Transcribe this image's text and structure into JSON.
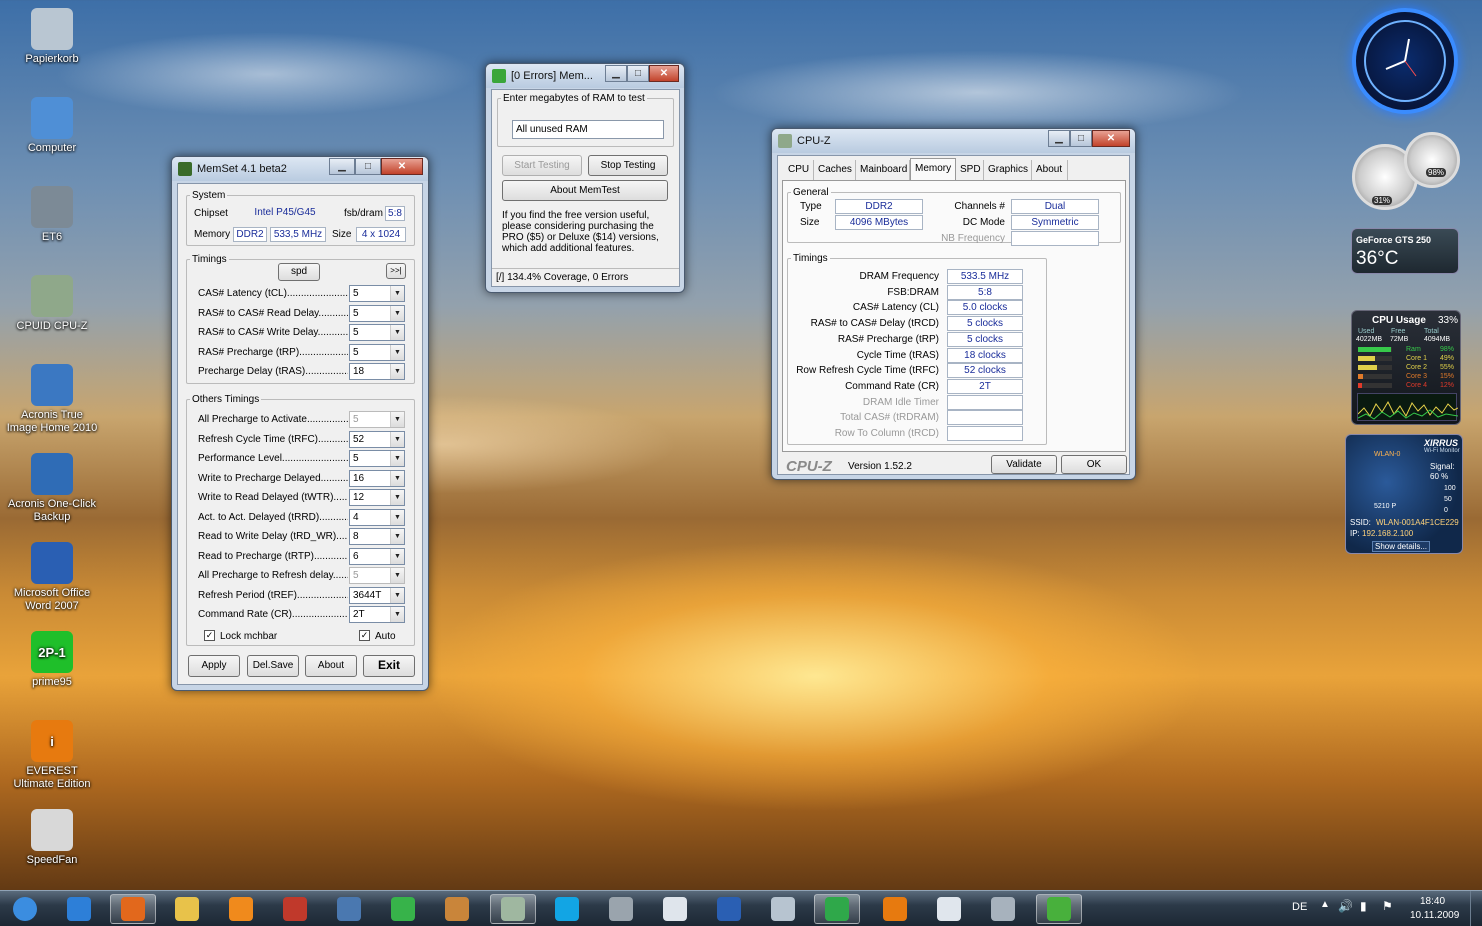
{
  "desktop_icons": [
    {
      "label": "Papierkorb",
      "icon": "recycle-bin-icon",
      "color": "#b9c6d2"
    },
    {
      "label": "Computer",
      "icon": "computer-icon",
      "color": "#4f8fd6"
    },
    {
      "label": "ET6",
      "icon": "et6-icon",
      "color": "#7c8a96"
    },
    {
      "label": "CPUID CPU-Z",
      "icon": "cpuz-icon",
      "color": "#8fa88a"
    },
    {
      "label": "Acronis True Image Home 2010",
      "icon": "acronis-true-image-icon",
      "color": "#3b78c2"
    },
    {
      "label": "Acronis One-Click Backup",
      "icon": "acronis-backup-icon",
      "color": "#2f6cb6"
    },
    {
      "label": "Microsoft Office Word 2007",
      "icon": "word-icon",
      "color": "#2a5fb3"
    },
    {
      "label": "prime95",
      "icon": "prime95-icon",
      "color": "#1fbf2a",
      "glyph": "2P-1"
    },
    {
      "label": "EVEREST Ultimate Edition",
      "icon": "everest-icon",
      "color": "#e77a0f",
      "glyph": "i"
    },
    {
      "label": "SpeedFan",
      "icon": "speedfan-icon",
      "color": "#d8d8d8"
    }
  ],
  "memset": {
    "title": "MemSet 4.1 beta2",
    "system_legend": "System",
    "chipset_label": "Chipset",
    "chipset_value": "Intel P45/G45",
    "fsb_label": "fsb/dram",
    "fsb_value": "5:8",
    "memory_label": "Memory",
    "memory_type": "DDR2",
    "memory_freq": "533,5 MHz",
    "size_label": "Size",
    "size_value": "4 x 1024",
    "timings_legend": "Timings",
    "spd_button": "spd",
    "more_button": ">>|",
    "timings": [
      {
        "label": "CAS# Latency (tCL)......................",
        "value": "5"
      },
      {
        "label": "RAS# to CAS# Read Delay...........",
        "value": "5"
      },
      {
        "label": "RAS# to CAS# Write Delay...........",
        "value": "5"
      },
      {
        "label": "RAS# Precharge (tRP)......................",
        "value": "5"
      },
      {
        "label": "Precharge Delay  (tRAS).................",
        "value": "18"
      }
    ],
    "others_legend": "Others Timings",
    "others": [
      {
        "label": "All Precharge to Activate.....................",
        "value": "5",
        "disabled": true
      },
      {
        "label": "Refresh Cycle Time (tRFC)................",
        "value": "52"
      },
      {
        "label": "Performance Level................................",
        "value": "5"
      },
      {
        "label": "Write to Precharge Delayed..................",
        "value": "16"
      },
      {
        "label": "Write to Read Delayed (tWTR)..........",
        "value": "12"
      },
      {
        "label": "Act. to Act. Delayed (tRRD)..............",
        "value": "4"
      },
      {
        "label": "Read to Write Delay (tRD_WR).........",
        "value": "8"
      },
      {
        "label": "Read to Precharge (tRTP)...................",
        "value": "6"
      },
      {
        "label": "All Precharge to Refresh delay............",
        "value": "5",
        "disabled": true
      },
      {
        "label": "Refresh Period (tREF)......................",
        "value": "3644T"
      },
      {
        "label": "Command Rate (CR)...............................",
        "value": "2T"
      }
    ],
    "lock_label": "Lock mchbar",
    "auto_label": "Auto",
    "apply": "Apply",
    "delsave": "Del.Save",
    "about": "About",
    "exit": "Exit"
  },
  "memtest": {
    "title": "[0 Errors] Mem...",
    "legend": "Enter megabytes of RAM to test",
    "input_value": "All unused RAM",
    "start": "Start Testing",
    "stop": "Stop Testing",
    "about": "About MemTest",
    "info": "If you find the free version useful, please considering purchasing the PRO ($5) or Deluxe ($14) versions, which add additional features.",
    "status": "[/]  134.4% Coverage, 0 Errors"
  },
  "cpuz": {
    "title": "CPU-Z",
    "tabs": [
      "CPU",
      "Caches",
      "Mainboard",
      "Memory",
      "SPD",
      "Graphics",
      "About"
    ],
    "active_tab": "Memory",
    "general_legend": "General",
    "type_label": "Type",
    "type_value": "DDR2",
    "size_label": "Size",
    "size_value": "4096 MBytes",
    "channels_label": "Channels #",
    "channels_value": "Dual",
    "dcmode_label": "DC Mode",
    "dcmode_value": "Symmetric",
    "nbfreq_label": "NB Frequency",
    "nbfreq_value": "",
    "timings_legend": "Timings",
    "timings": [
      {
        "label": "DRAM Frequency",
        "value": "533.5 MHz"
      },
      {
        "label": "FSB:DRAM",
        "value": "5:8"
      },
      {
        "label": "CAS# Latency (CL)",
        "value": "5.0 clocks"
      },
      {
        "label": "RAS# to CAS# Delay (tRCD)",
        "value": "5 clocks"
      },
      {
        "label": "RAS# Precharge (tRP)",
        "value": "5 clocks"
      },
      {
        "label": "Cycle Time (tRAS)",
        "value": "18 clocks"
      },
      {
        "label": "Row Refresh Cycle Time (tRFC)",
        "value": "52 clocks"
      },
      {
        "label": "Command Rate (CR)",
        "value": "2T"
      },
      {
        "label": "DRAM Idle Timer",
        "value": "",
        "disabled": true
      },
      {
        "label": "Total CAS# (tRDRAM)",
        "value": "",
        "disabled": true
      },
      {
        "label": "Row To Column (tRCD)",
        "value": "",
        "disabled": true
      }
    ],
    "brand": "CPU-Z",
    "version": "Version 1.52.2",
    "validate": "Validate",
    "ok": "OK"
  },
  "gadgets": {
    "gpu_name": "GeForce GTS 250",
    "gpu_temp": "36°C",
    "meter_left": "31%",
    "meter_right": "98%",
    "cpu_title": "CPU Usage",
    "cpu_total": "33%",
    "mem_headers": [
      "Used",
      "Free",
      "Total"
    ],
    "mem_values": [
      "4022MB",
      "72MB",
      "4094MB"
    ],
    "cores": [
      {
        "name": "Ram",
        "pct": "98%",
        "level": 0.98
      },
      {
        "name": "Core 1",
        "pct": "49%",
        "level": 0.49
      },
      {
        "name": "Core 2",
        "pct": "55%",
        "level": 0.55
      },
      {
        "name": "Core 3",
        "pct": "15%",
        "level": 0.15
      },
      {
        "name": "Core 4",
        "pct": "12%",
        "level": 0.12
      }
    ],
    "wifi_brand": "XIRRUS",
    "wifi_sub": "Wi-Fi Monitor",
    "wifi_signal_label": "Signal:",
    "wifi_signal": "60 %",
    "wifi_scale": [
      "100",
      "50",
      "0"
    ],
    "wifi_ssid_label": "SSID:",
    "wifi_ssid": "WLAN-001A4F1CE229",
    "wifi_ip_label": "IP:",
    "wifi_ip": "192.168.2.100",
    "wifi_network": "WLAN-0",
    "wifi_rate": "5210 P",
    "wifi_details": "Show details..."
  },
  "taskbar": {
    "apps": [
      {
        "icon": "start-orb-icon",
        "color": "#3b8de0"
      },
      {
        "icon": "internet-explorer-icon",
        "color": "#2d7fd8"
      },
      {
        "icon": "firefox-icon",
        "color": "#e2681c",
        "active": true
      },
      {
        "icon": "explorer-folder-icon",
        "color": "#e8c24a"
      },
      {
        "icon": "media-player-icon",
        "color": "#f08a1c"
      },
      {
        "icon": "toolbox-icon",
        "color": "#c0392b"
      },
      {
        "icon": "task-manager-icon",
        "color": "#4a78b0"
      },
      {
        "icon": "icq-icon",
        "color": "#37b34a"
      },
      {
        "icon": "memset-icon",
        "color": "#c9853a"
      },
      {
        "icon": "cpuz-taskbar-icon",
        "color": "#9fb7a0",
        "active": true
      },
      {
        "icon": "skype-icon",
        "color": "#12a5e4"
      },
      {
        "icon": "et6-taskbar-icon",
        "color": "#9aa4ad"
      },
      {
        "icon": "notepad-icon",
        "color": "#dfe5ec"
      },
      {
        "icon": "word-taskbar-icon",
        "color": "#2a5fb3"
      },
      {
        "icon": "network-icon",
        "color": "#b7c4d0"
      },
      {
        "icon": "memtest-taskbar-icon",
        "color": "#2fa84a",
        "active": true
      },
      {
        "icon": "everest-taskbar-icon",
        "color": "#e77a0f"
      },
      {
        "icon": "document-icon",
        "color": "#e0e6ed"
      },
      {
        "icon": "printer-icon",
        "color": "#a7b2bd"
      },
      {
        "icon": "memtest-icon",
        "color": "#48b03c",
        "active": true
      }
    ],
    "lang": "DE",
    "time": "18:40",
    "date": "10.11.2009"
  }
}
